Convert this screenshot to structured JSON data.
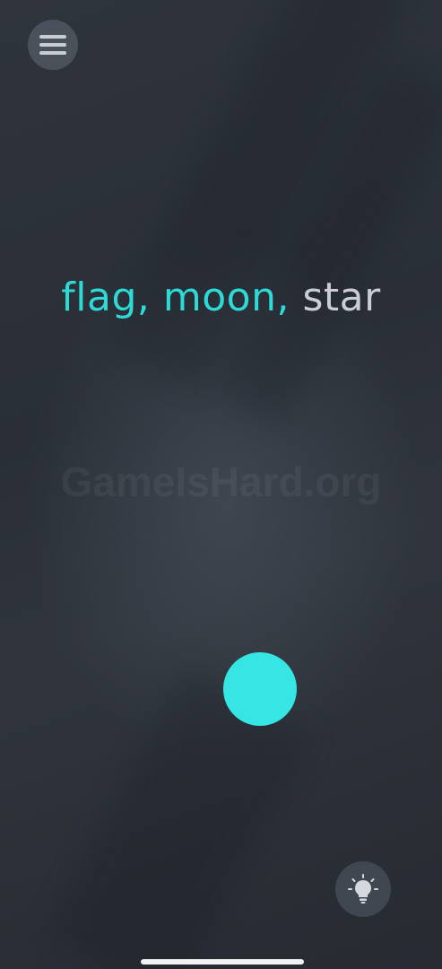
{
  "menu": {
    "icon": "hamburger-menu-icon"
  },
  "puzzle": {
    "words": [
      {
        "text": "flag,",
        "status": "found",
        "color": "#2fdad6"
      },
      {
        "text": "moon,",
        "status": "found",
        "color": "#2fdad6"
      },
      {
        "text": "star",
        "status": "pending",
        "color": "#c9ced4"
      }
    ]
  },
  "watermark": "GameIsHard.org",
  "tap_target": {
    "color": "#35e6e4"
  },
  "hint": {
    "icon": "lightbulb-icon"
  },
  "theme": {
    "background": "#2b3038",
    "accent": "#2fdad6"
  }
}
